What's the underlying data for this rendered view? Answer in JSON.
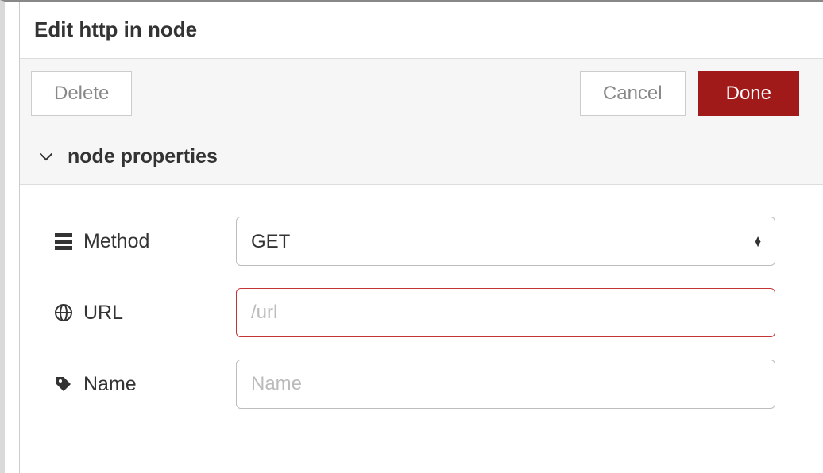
{
  "header": {
    "title": "Edit http in node"
  },
  "actions": {
    "delete_label": "Delete",
    "cancel_label": "Cancel",
    "done_label": "Done"
  },
  "section": {
    "title": "node properties"
  },
  "form": {
    "method": {
      "label": "Method",
      "value": "GET"
    },
    "url": {
      "label": "URL",
      "value": "",
      "placeholder": "/url"
    },
    "name": {
      "label": "Name",
      "value": "",
      "placeholder": "Name"
    }
  }
}
